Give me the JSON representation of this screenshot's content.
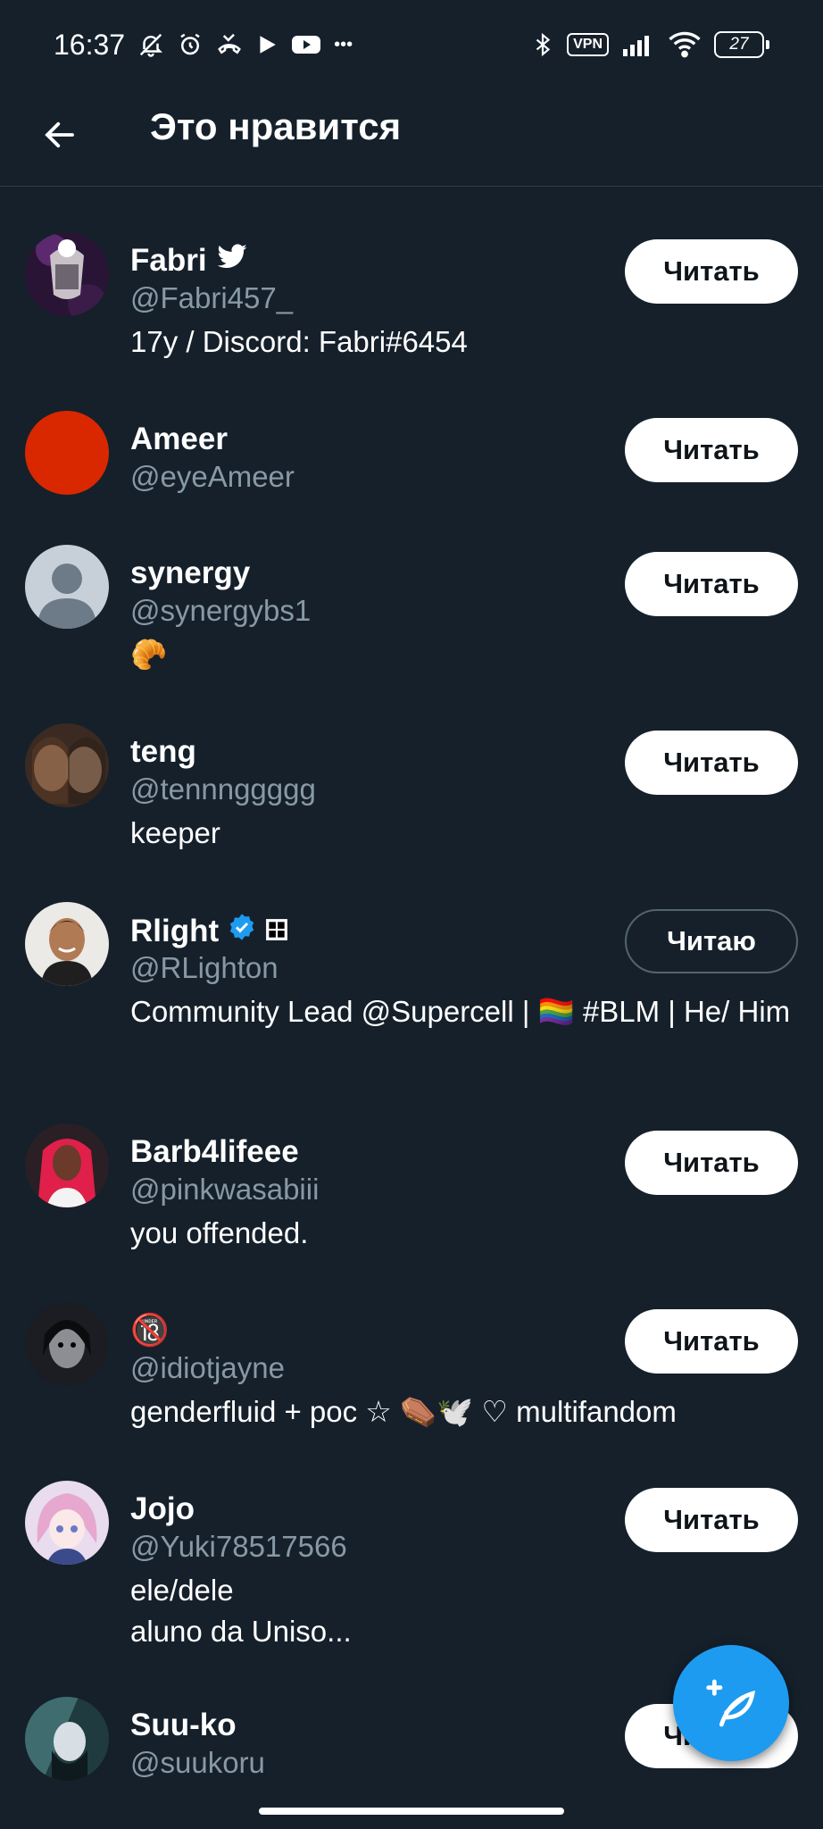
{
  "status_bar": {
    "time": "16:37",
    "vpn_label": "VPN",
    "battery": "27",
    "overflow": "•••"
  },
  "header": {
    "title": "Это нравится"
  },
  "users": [
    {
      "name": "Fabri",
      "handle": "@Fabri457_",
      "bio": "17y / Discord: Fabri#6454",
      "button": "Читать",
      "badge": "twitter-bird"
    },
    {
      "name": "Ameer",
      "handle": "@eyeAmeer",
      "bio": "",
      "button": "Читать"
    },
    {
      "name": "synergy",
      "handle": "@synergybs1",
      "bio": "🥐",
      "button": "Читать"
    },
    {
      "name": "teng",
      "handle": "@tennnggggg",
      "bio": "keeper",
      "button": "Читать"
    },
    {
      "name": "Rlight",
      "handle": "@RLighton",
      "bio": "Community Lead @Supercell | 🏳️‍🌈 #BLM | He/ Him",
      "button": "Читаю",
      "badge": "verified"
    },
    {
      "name": "Barb4lifeee",
      "handle": "@pinkwasabiii",
      "bio": "you offended.",
      "button": "Читать"
    },
    {
      "name": "🔞",
      "handle": "@idiotjayne",
      "bio": "genderfluid + poc ☆ ⚰️🕊️ ♡ multifandom",
      "button": "Читать"
    },
    {
      "name": "Jojo",
      "handle": "@Yuki78517566",
      "bio": "ele/dele\naluno da Uniso...",
      "button": "Читать"
    },
    {
      "name": "Suu-ko",
      "handle": "@suukoru",
      "bio": "",
      "button": "Читать"
    }
  ],
  "colors": {
    "background": "#15202b",
    "accent": "#1d9bf0",
    "secondary_text": "#8899a6"
  }
}
